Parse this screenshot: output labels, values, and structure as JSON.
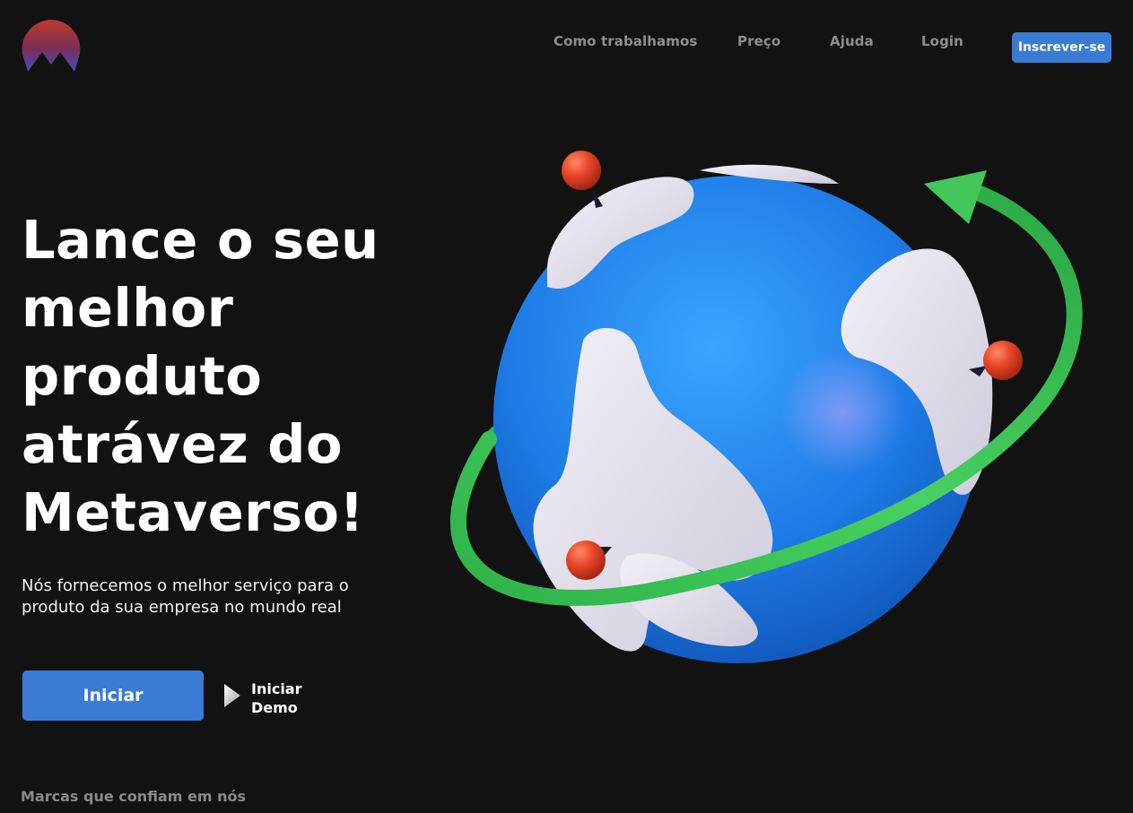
{
  "header": {
    "logo_icon": "mountain-logo-icon",
    "nav": {
      "how_we_work": "Como trabalhamos",
      "pricing": "Preço",
      "help": "Ajuda",
      "login": "Login"
    },
    "signup_label": "Inscrever-se"
  },
  "hero": {
    "title": "Lance o seu melhor produto atrávez do Metaverso!",
    "subtitle": "Nós fornecemos o melhor serviço para o produto da sua empresa no mundo real",
    "start_label": "Iniciar",
    "demo_icon": "play-icon",
    "demo_label": "Iniciar Demo",
    "illustration": "globe-with-pins-and-orbit-arrow"
  },
  "brands": {
    "title": "Marcas que confiam em nós"
  },
  "colors": {
    "background": "#121212",
    "accent": "#3a7bd5",
    "muted_text": "#8e8e8e",
    "globe_blue": "#1e7be6",
    "orbit_green": "#3fc457",
    "pin_red": "#e8452a"
  }
}
